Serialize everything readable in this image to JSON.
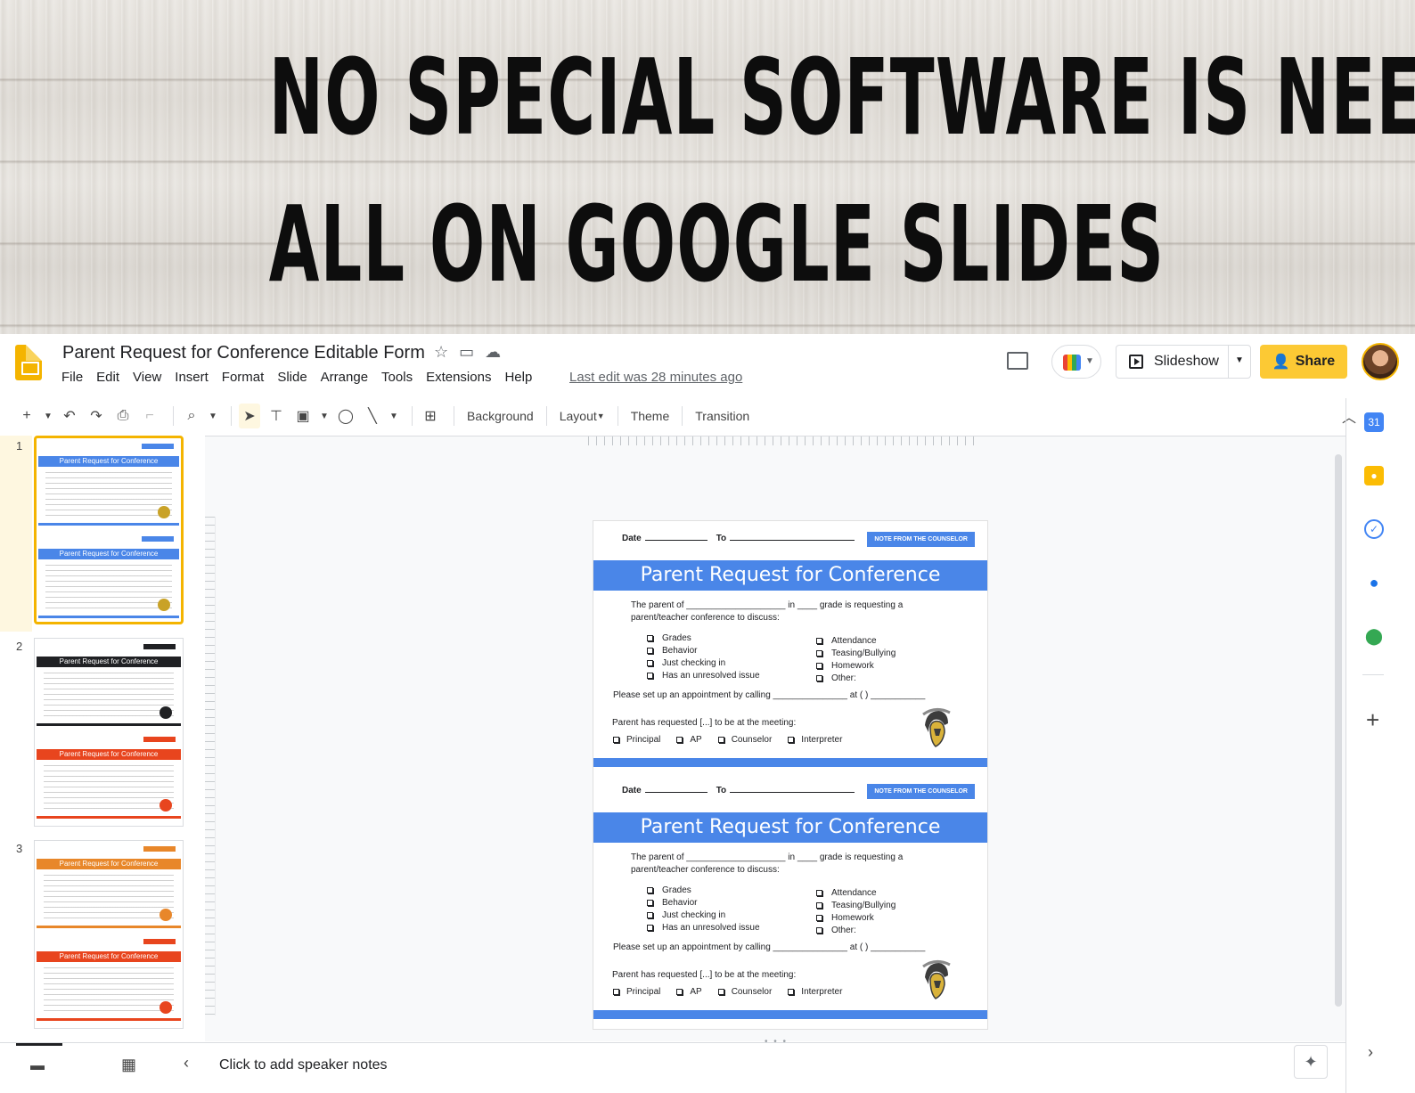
{
  "banner": {
    "line1": "NO SPECIAL SOFTWARE IS NEEDED. EDIT",
    "line2": "ALL ON GOOGLE SLIDES"
  },
  "app": {
    "doc_title": "Parent Request for Conference Editable Form",
    "menu": [
      "File",
      "Edit",
      "View",
      "Insert",
      "Format",
      "Slide",
      "Arrange",
      "Tools",
      "Extensions",
      "Help"
    ],
    "last_edit": "Last edit was 28 minutes ago",
    "slideshow_label": "Slideshow",
    "share_label": "Share",
    "accent_color": "#fcc934"
  },
  "toolbar": {
    "background_label": "Background",
    "layout_label": "Layout",
    "theme_label": "Theme",
    "transition_label": "Transition"
  },
  "filmstrip": {
    "slides": [
      {
        "number": "1",
        "top_color": "#4a86e8",
        "bottom_color": "#4a86e8",
        "top_mascot": "#c9a227",
        "bottom_mascot": "#c9a227",
        "header": "Parent Request for Conference"
      },
      {
        "number": "2",
        "top_color": "#202124",
        "bottom_color": "#e8451e",
        "top_mascot": "#202124",
        "bottom_mascot": "#e8451e",
        "header": "Parent Request for Conference"
      },
      {
        "number": "3",
        "top_color": "#e8872a",
        "bottom_color": "#e8451e",
        "top_mascot": "#e8872a",
        "bottom_mascot": "#e8451e",
        "header": "Parent Request for Conference"
      }
    ]
  },
  "slide": {
    "date_label": "Date",
    "to_label": "To",
    "note_tag": "NOTE FROM THE COUNSELOR",
    "heading": "Parent Request for Conference",
    "intro_line1": "The parent of ____________________ in ____ grade is requesting a",
    "intro_line2": "parent/teacher conference to discuss:",
    "left_items": [
      "Grades",
      "Behavior",
      "Just checking in",
      "Has an unresolved issue"
    ],
    "right_items": [
      "Attendance",
      "Teasing/Bullying",
      "Homework",
      "Other:"
    ],
    "appointment": "Please set up an appointment by calling _______________ at (      ) ___________",
    "requested": "Parent has requested [...] to be at the meeting:",
    "roles": [
      "Principal",
      "AP",
      "Counselor",
      "Interpreter"
    ],
    "theme_color": "#4a86e8"
  },
  "notes": {
    "placeholder": "Click to add speaker notes"
  }
}
